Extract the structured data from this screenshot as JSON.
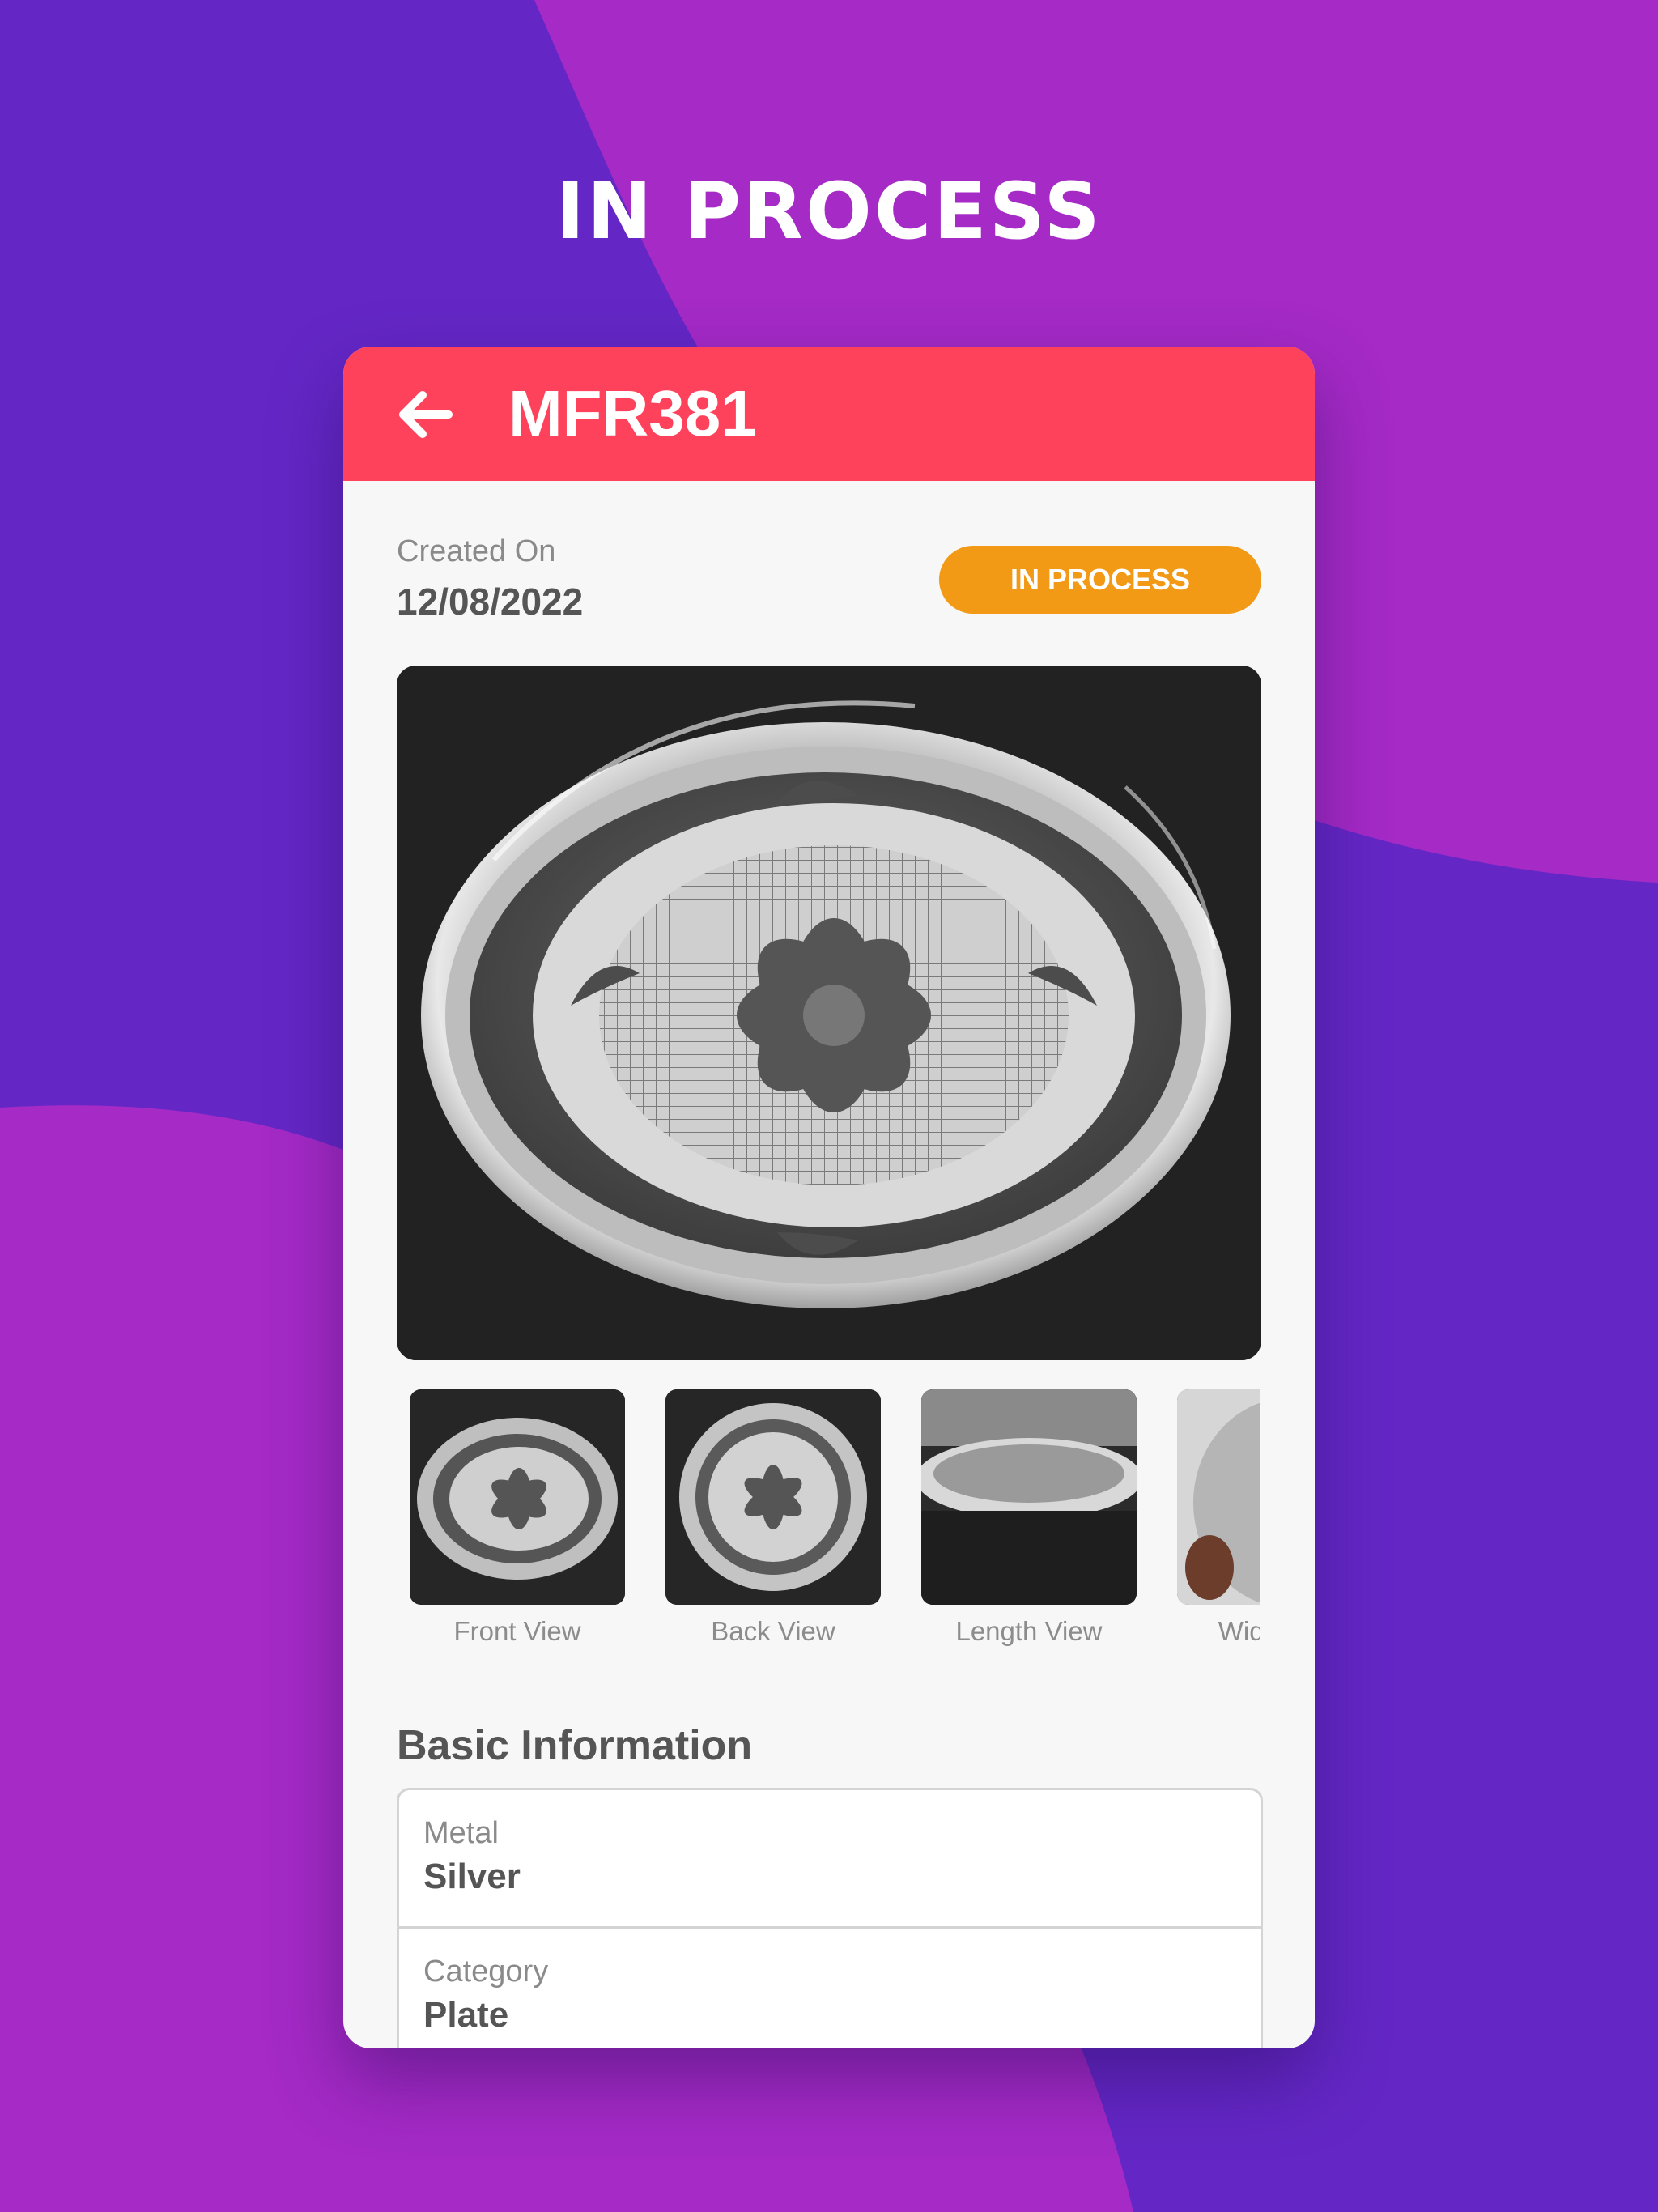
{
  "hero": {
    "title": "IN PROCESS"
  },
  "appbar": {
    "title": "MFR381",
    "back_icon": "arrow-left-icon"
  },
  "order": {
    "created_label": "Created On",
    "created_date": "12/08/2022",
    "status": "IN PROCESS"
  },
  "thumbnails": [
    {
      "label": "Front View"
    },
    {
      "label": "Back View"
    },
    {
      "label": "Length View"
    },
    {
      "label": "Width View"
    }
  ],
  "basic_info": {
    "title": "Basic Information",
    "rows": [
      {
        "label": "Metal",
        "value": "Silver"
      },
      {
        "label": "Category",
        "value": "Plate"
      }
    ]
  },
  "colors": {
    "background_purple": "#6427c6",
    "background_magenta": "#a52ac6",
    "appbar_red": "#ff425c",
    "status_orange": "#f29a16"
  }
}
